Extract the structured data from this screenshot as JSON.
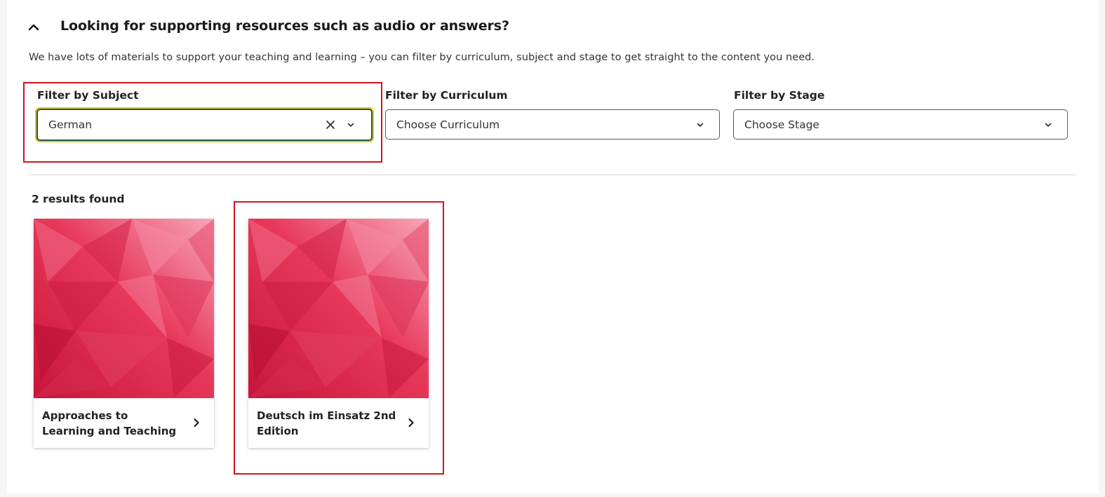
{
  "accordion": {
    "title": "Looking for supporting resources such as audio or answers?",
    "description": "We have lots of materials to support your teaching and learning – you can filter by curriculum, subject and stage to get straight to the content you need.",
    "toggle_icon": "chevron-up-icon"
  },
  "filters": {
    "subject": {
      "label": "Filter by Subject",
      "value": "German",
      "clear_icon": "close-icon",
      "dropdown_icon": "chevron-down-icon"
    },
    "curriculum": {
      "label": "Filter by Curriculum",
      "value": "Choose Curriculum",
      "dropdown_icon": "chevron-down-icon"
    },
    "stage": {
      "label": "Filter by Stage",
      "value": "Choose Stage",
      "dropdown_icon": "chevron-down-icon"
    }
  },
  "results": {
    "count_text": "2 results found",
    "items": [
      {
        "title": "Approaches to Learning and Teaching",
        "arrow_icon": "chevron-right-icon"
      },
      {
        "title": "Deutsch im Einsatz 2nd Edition",
        "arrow_icon": "chevron-right-icon"
      }
    ]
  },
  "colors": {
    "highlight": "#d4141c",
    "focus_ring": "#f2c100",
    "focus_border": "#1c5a63",
    "cover_pink": "#e8385a"
  }
}
